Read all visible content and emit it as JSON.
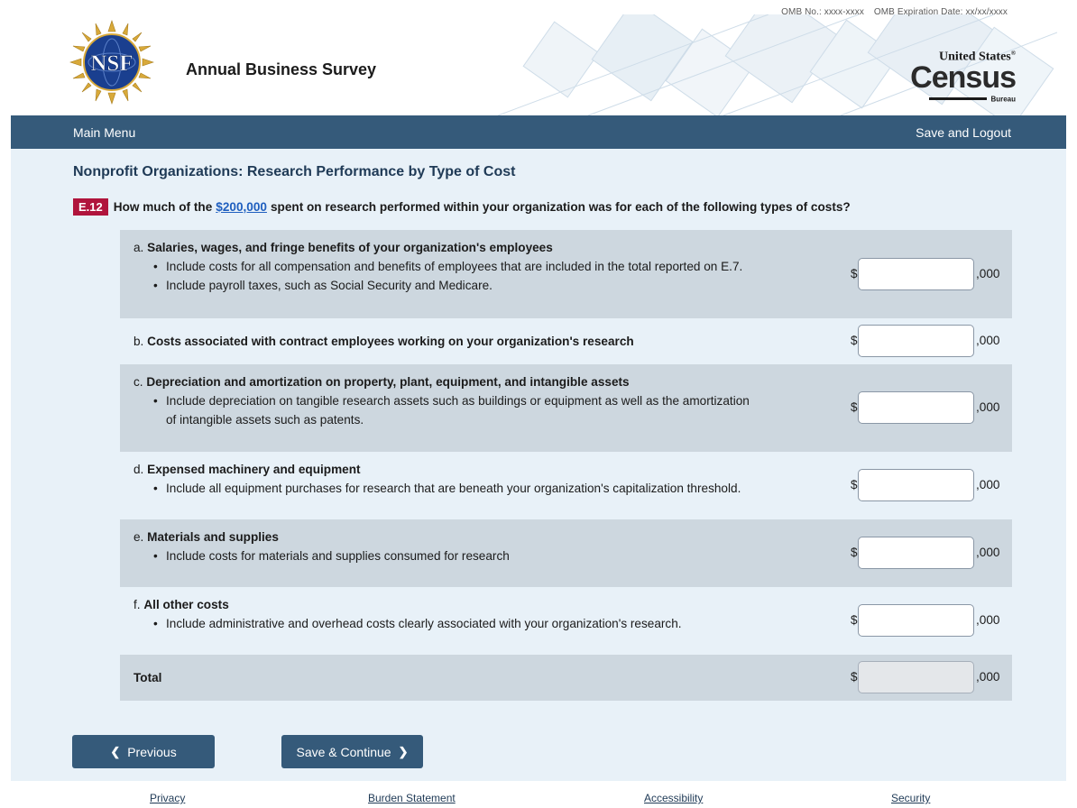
{
  "header": {
    "omb_number": "OMB No.: xxxx-xxxx",
    "omb_expiration": "OMB Expiration Date: xx/xx/xxxx",
    "app_title": "Annual Business Survey",
    "nsf_logo_text": "NSF",
    "census_logo": {
      "top": "United States",
      "main": "Census",
      "bottom": "Bureau"
    }
  },
  "nav": {
    "main_menu": "Main Menu",
    "save_logout": "Save and Logout"
  },
  "section_title": "Nonprofit Organizations: Research Performance by Type of Cost",
  "question": {
    "number": "E.12",
    "text_before": "How much of the",
    "amount_link": "$200,000",
    "text_after": "spent on research performed within your organization was for each of the following types of costs?"
  },
  "items": [
    {
      "letter": "a.",
      "title": "Salaries, wages, and fringe benefits of your organization's employees",
      "bullets": [
        "Include costs for all compensation and benefits of employees that are included in the total reported on E.7.",
        "Include payroll taxes, such as Social Security and Medicare."
      ],
      "currency": "$",
      "value": "",
      "suffix": ",000"
    },
    {
      "letter": "b.",
      "title": "Costs associated with contract employees working on your organization's research",
      "bullets": [],
      "currency": "$",
      "value": "",
      "suffix": ",000"
    },
    {
      "letter": "c.",
      "title": "Depreciation and amortization on property, plant, equipment, and intangible assets",
      "bullets": [
        "Include depreciation on tangible research assets such as buildings or equipment as well as the amortization",
        "of intangible assets such as patents."
      ],
      "currency": "$",
      "value": "",
      "suffix": ",000"
    },
    {
      "letter": "d.",
      "title": "Expensed machinery and equipment",
      "bullets": [
        "Include all equipment purchases for research that are beneath your organization's capitalization threshold."
      ],
      "currency": "$",
      "value": "",
      "suffix": ",000"
    },
    {
      "letter": "e.",
      "title": "Materials and supplies",
      "bullets": [
        "Include costs for materials and supplies consumed for research"
      ],
      "currency": "$",
      "value": "",
      "suffix": ",000"
    },
    {
      "letter": "f.",
      "title": "All other costs",
      "bullets": [
        "Include administrative and overhead costs clearly associated with your organization's research."
      ],
      "currency": "$",
      "value": "",
      "suffix": ",000"
    }
  ],
  "total": {
    "label": "Total",
    "currency": "$",
    "value": "",
    "suffix": ",000"
  },
  "buttons": {
    "previous": "Previous",
    "save_continue": "Save & Continue"
  },
  "footer": {
    "privacy": "Privacy",
    "burden": "Burden Statement",
    "accessibility": "Accessibility",
    "security": "Security"
  },
  "colors": {
    "navbar": "#355a7a",
    "page_bg": "#e8f1f8",
    "row_shade": "#cdd7df",
    "badge": "#b0143c",
    "link": "#1f5fbf"
  }
}
